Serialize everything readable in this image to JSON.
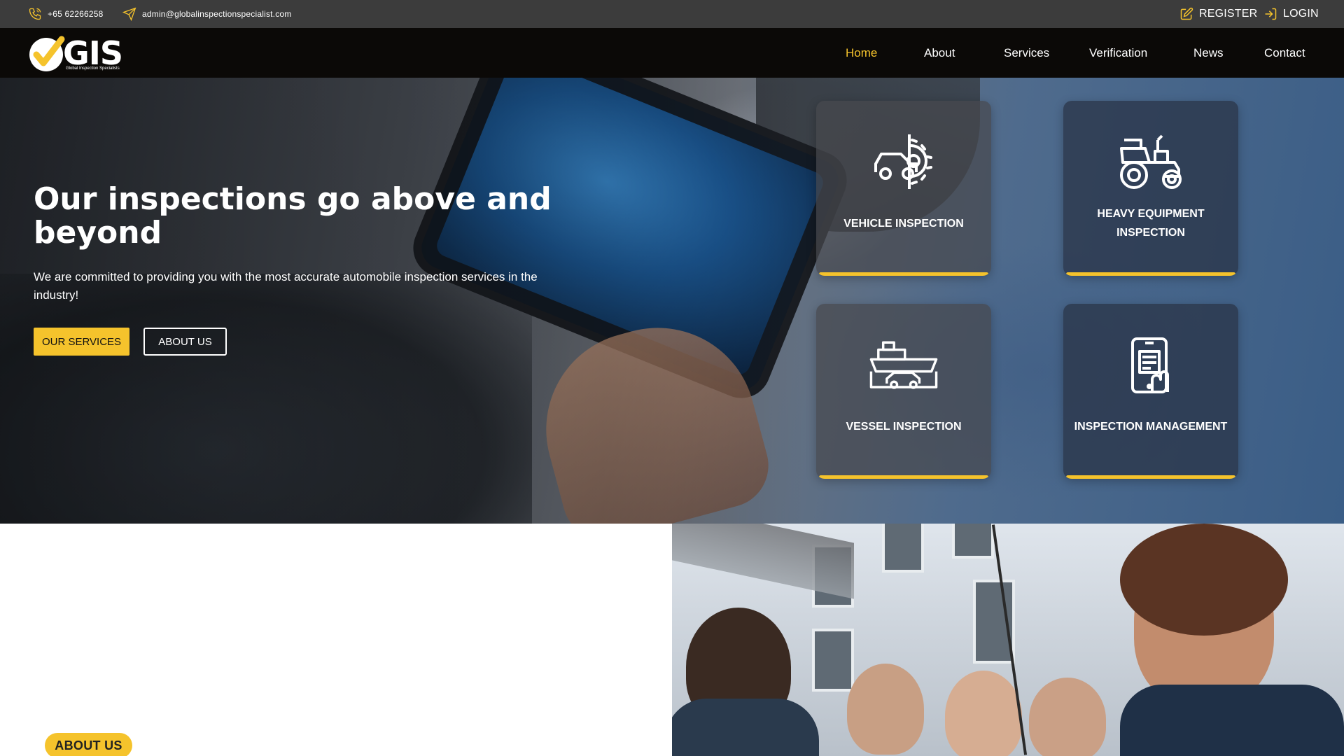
{
  "topbar": {
    "phone": "+65 62266258",
    "email": "admin@globalinspectionspecialist.com",
    "register": "REGISTER",
    "login": "LOGIN"
  },
  "logo": {
    "text": "GIS",
    "subtitle": "Global Inspection Specialists"
  },
  "nav": {
    "items": [
      {
        "label": "Home",
        "active": true
      },
      {
        "label": "About",
        "active": false
      },
      {
        "label": "Services",
        "active": false
      },
      {
        "label": "Verification",
        "active": false
      },
      {
        "label": "News",
        "active": false
      },
      {
        "label": "Contact",
        "active": false
      }
    ]
  },
  "hero": {
    "title": "Our inspections go above and beyond",
    "subtitle": "We are committed to providing you with the most accurate automobile inspection services in the industry!",
    "primary_button": "OUR SERVICES",
    "secondary_button": "ABOUT US"
  },
  "cards": [
    {
      "label": "VEHICLE INSPECTION",
      "icon": "car-gear-icon"
    },
    {
      "label": "HEAVY EQUIPMENT INSPECTION",
      "icon": "tractor-icon"
    },
    {
      "label": "VESSEL INSPECTION",
      "icon": "ship-car-icon"
    },
    {
      "label": "INSPECTION MANAGEMENT",
      "icon": "phone-document-icon"
    }
  ],
  "about": {
    "badge": "ABOUT US"
  },
  "colors": {
    "accent": "#f5c32c",
    "topbar": "#3c3c3c",
    "nav": "#0b0907"
  }
}
